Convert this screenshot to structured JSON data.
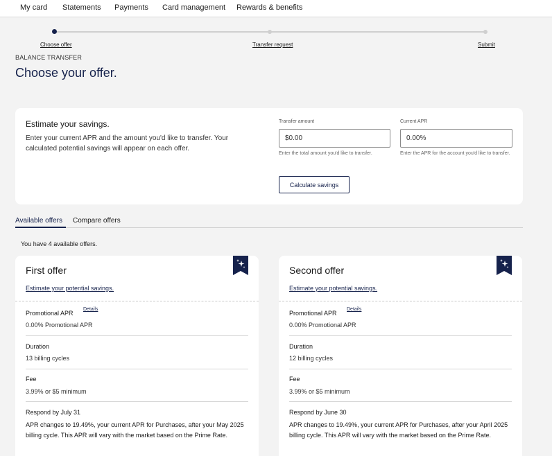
{
  "nav": {
    "items": [
      "My card",
      "Statements",
      "Payments",
      "Card management",
      "Rewards & benefits"
    ]
  },
  "stepper": {
    "steps": [
      {
        "label": "Choose offer",
        "state": "active"
      },
      {
        "label": "Transfer request",
        "state": "pending"
      },
      {
        "label": "Submit",
        "state": "pending"
      }
    ]
  },
  "page": {
    "eyebrow": "BALANCE TRANSFER",
    "title": "Choose your offer."
  },
  "savings": {
    "title": "Estimate your savings.",
    "description": "Enter your current APR and the amount you'd like to transfer. Your calculated potential savings will appear on each offer.",
    "transfer": {
      "label": "Transfer amount",
      "value": "$0.00",
      "hint": "Enter the total amount you'd like to transfer."
    },
    "apr": {
      "label": "Current APR",
      "value": "0.00%",
      "hint": "Enter the APR for the account you'd like to transfer."
    },
    "button": "Calculate savings"
  },
  "tabs": [
    "Available offers",
    "Compare offers"
  ],
  "offers_count": "You have 4 available offers.",
  "offers": [
    {
      "title": "First offer",
      "link": "Estimate your potential savings.",
      "promo_label": "Promotional APR",
      "details": "Details",
      "promo_value": "0.00% Promotional APR",
      "duration_label": "Duration",
      "duration_value": "13 billing cycles",
      "fee_label": "Fee",
      "fee_value": "3.99% or $5 minimum",
      "respond_label": "Respond by July 31",
      "respond_text": "APR changes to 19.49%, your current APR for Purchases, after your May 2025 billing cycle. This APR will vary with the market based on the Prime Rate."
    },
    {
      "title": "Second offer",
      "link": "Estimate your potential savings.",
      "promo_label": "Promotional APR",
      "details": "Details",
      "promo_value": "0.00% Promotional APR",
      "duration_label": "Duration",
      "duration_value": "12 billing cycles",
      "fee_label": "Fee",
      "fee_value": "3.99% or $5 minimum",
      "respond_label": "Respond by June 30",
      "respond_text": "APR changes to 19.49%, your current APR for Purchases, after your April 2025 billing cycle. This APR will vary with the market based on the Prime Rate."
    }
  ],
  "colors": {
    "brand": "#16224c",
    "background": "#f3f3f3",
    "card": "#ffffff"
  },
  "icons": {
    "offer_badge": "sparkle-icon"
  }
}
